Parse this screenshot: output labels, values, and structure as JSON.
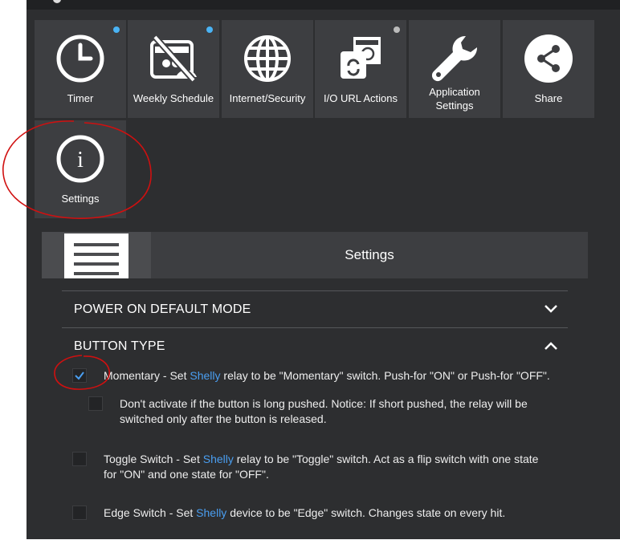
{
  "tiles": [
    {
      "label": "Timer",
      "icon": "clock-icon",
      "dot": "#4ab3f4"
    },
    {
      "label": "Weekly Schedule",
      "icon": "weekly-schedule-icon",
      "dot": "#4ab3f4"
    },
    {
      "label": "Internet/Security",
      "icon": "globe-icon",
      "dot": null
    },
    {
      "label": "I/O URL Actions",
      "icon": "io-url-actions-icon",
      "dot": "#bbbbbb"
    },
    {
      "label": "Application Settings",
      "icon": "wrench-icon",
      "dot": null
    },
    {
      "label": "Share",
      "icon": "share-icon",
      "dot": null
    },
    {
      "label": "Settings",
      "icon": "info-icon",
      "dot": null
    }
  ],
  "header": {
    "title": "Settings"
  },
  "sections": {
    "power_on": {
      "title": "POWER ON DEFAULT MODE"
    },
    "button_type": {
      "title": "BUTTON TYPE"
    }
  },
  "options": {
    "momentary": {
      "pre": "Momentary - Set ",
      "brand": "Shelly",
      "post": " relay to be \"Momentary\" switch. Push-for \"ON\" or Push-for \"OFF\".",
      "checked": true
    },
    "long_push": {
      "line1": "Don't activate if the button is long pushed. Notice: If short pushed, the relay will be",
      "line2": "switched only after the button is released.",
      "checked": false
    },
    "toggle": {
      "pre": "Toggle Switch - Set ",
      "brand": "Shelly",
      "post": " relay to be \"Toggle\" switch. Act as a flip switch with one state",
      "line2": "for \"ON\" and one state for \"OFF\".",
      "checked": false
    },
    "edge": {
      "pre": "Edge Switch - Set ",
      "brand": "Shelly",
      "post": " device to be \"Edge\" switch. Changes state on every hit.",
      "checked": false
    }
  },
  "colors": {
    "brand": "#4a9ef0",
    "annotation": "#d01010"
  }
}
